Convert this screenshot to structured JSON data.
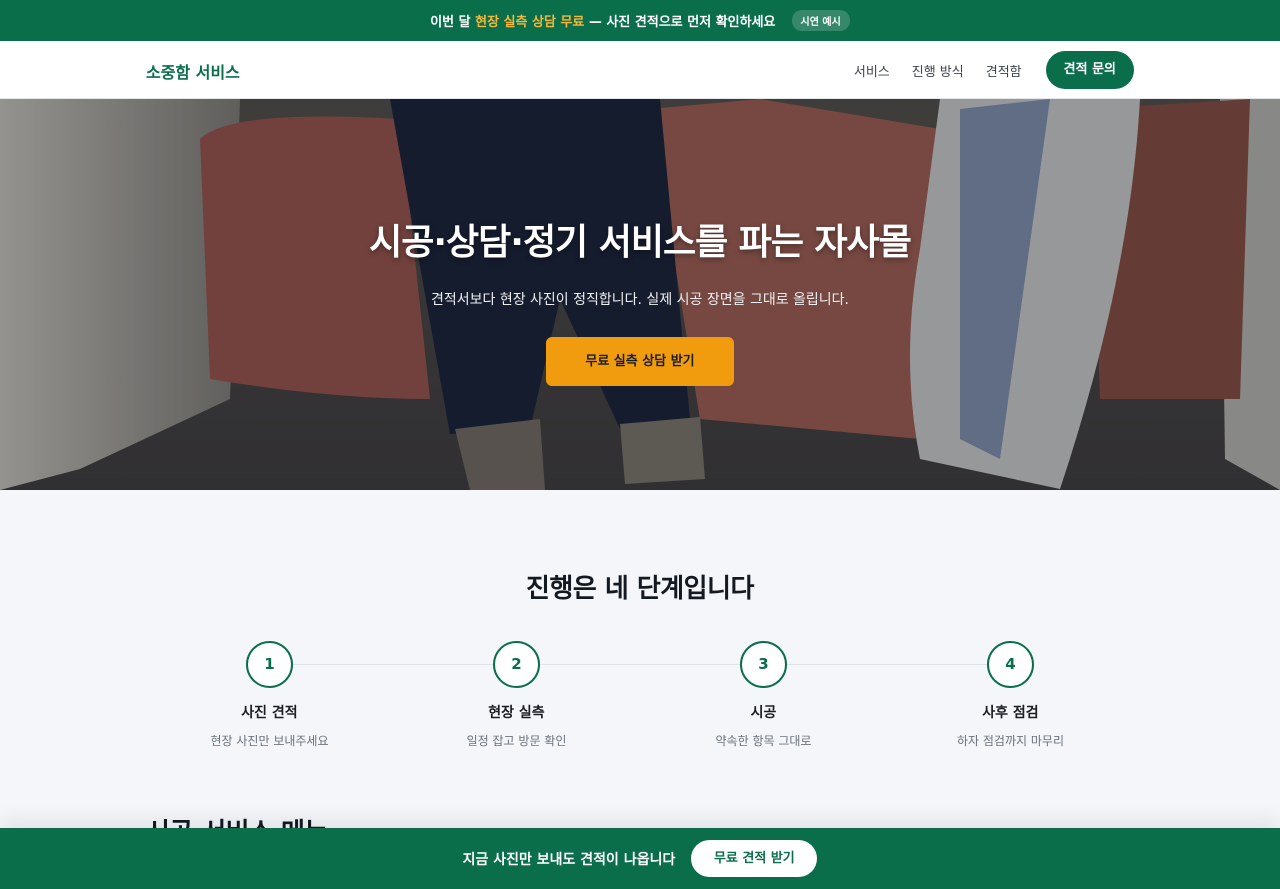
{
  "announcement": {
    "prefix": "이번 달",
    "highlight": "현장 실측 상담 무료",
    "suffix": "— 사진 견적으로 먼저 확인하세요",
    "chip": "시연 예시"
  },
  "header": {
    "logo": "소중함 서비스",
    "nav": [
      "서비스",
      "진행 방식",
      "견적함"
    ],
    "cta": "견적 문의"
  },
  "hero": {
    "title": "시공·상담·정기 서비스를 파는 자사몰",
    "subtitle": "견적서보다 현장 사진이 정직합니다. 실제 시공 장면을 그대로 올립니다.",
    "button": "무료 실측 상담 받기"
  },
  "steps": {
    "heading": "진행은 네 단계입니다",
    "items": [
      {
        "num": "1",
        "title": "사진 견적",
        "desc": "현장 사진만 보내주세요"
      },
      {
        "num": "2",
        "title": "현장 실측",
        "desc": "일정 잡고 방문 확인"
      },
      {
        "num": "3",
        "title": "시공",
        "desc": "약속한 항목 그대로"
      },
      {
        "num": "4",
        "title": "사후 점검",
        "desc": "하자 점검까지 마무리"
      }
    ]
  },
  "menu_section": {
    "heading": "시공·서비스 메뉴"
  },
  "bottom_bar": {
    "text": "지금 사진만 보내도 견적이 나옵니다",
    "button": "무료 견적 받기"
  },
  "colors": {
    "brand": "#0a6e4b",
    "accent": "#f09c0e",
    "highlight": "#f5b83a"
  }
}
